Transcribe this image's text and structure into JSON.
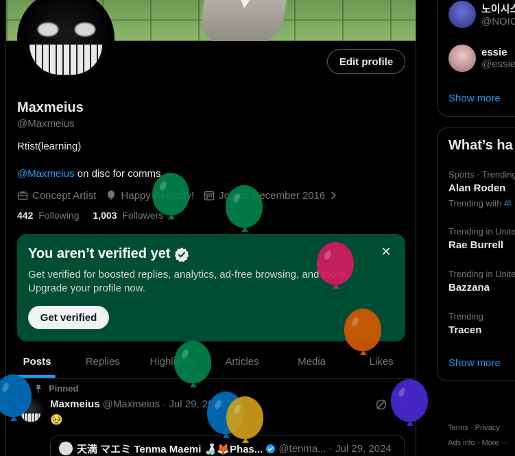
{
  "profile": {
    "display_name": "Maxmeius",
    "handle": "@Maxmeius",
    "bio_line1": "Rtist(learning)",
    "bio_mention": "@Maxmeius",
    "bio_rest": "on disc for comms",
    "profession": "Concept Artist",
    "birthday": "Happy Birthday!",
    "joined": "Joined December 2016",
    "following_count": "442",
    "following_label": "Following",
    "followers_count": "1,003",
    "followers_label": "Followers",
    "edit_label": "Edit profile"
  },
  "verify": {
    "title": "You aren’t verified yet",
    "desc": "Get verified for boosted replies, analytics, ad-free browsing, and more. Upgrade your profile now.",
    "button": "Get verified",
    "close": "✕"
  },
  "tabs": [
    {
      "label": "Posts"
    },
    {
      "label": "Replies"
    },
    {
      "label": "Highlights"
    },
    {
      "label": "Articles"
    },
    {
      "label": "Media"
    },
    {
      "label": "Likes"
    }
  ],
  "post": {
    "pinned": "Pinned",
    "author": "Maxmeius",
    "meta": "@Maxmeius · Jul 29, 2024",
    "emoji": "🥹",
    "more": "···",
    "quote_author": "天満 マエミ Tenma Maemi 🍶🦊Phas...",
    "quote_meta": "@tenma... · Jul 29, 2024"
  },
  "sidebar": {
    "who": [
      {
        "name": "노이시스",
        "handle": "@NOIC"
      },
      {
        "name": "essie",
        "handle": "@essie"
      }
    ],
    "show_more_1": "Show more",
    "trend_title": "What’s ha",
    "trends": [
      {
        "context": "Sports · Trending",
        "name": "Alan Roden",
        "with_label": "Trending with",
        "with_tag": "#l"
      },
      {
        "context": "Trending in Unite",
        "name": "Rae Burrell"
      },
      {
        "context": "Trending in Unite",
        "name": "Bazzana"
      },
      {
        "context": "Trending",
        "name": "Tracen"
      }
    ],
    "show_more_2": "Show more",
    "footer_terms": "Terms",
    "footer_privacy": "Privacy",
    "footer_ads": "Ads info",
    "footer_more": "More ···"
  },
  "colors": {
    "accent": "#1d9bf0",
    "verify_bg": "#004d36",
    "balloon_green": "#00874e",
    "balloon_pink": "#d81b60",
    "balloon_orange": "#d65a00",
    "balloon_blue": "#0070c0",
    "balloon_purple": "#4b2bd6",
    "balloon_gold": "#d4a017"
  }
}
